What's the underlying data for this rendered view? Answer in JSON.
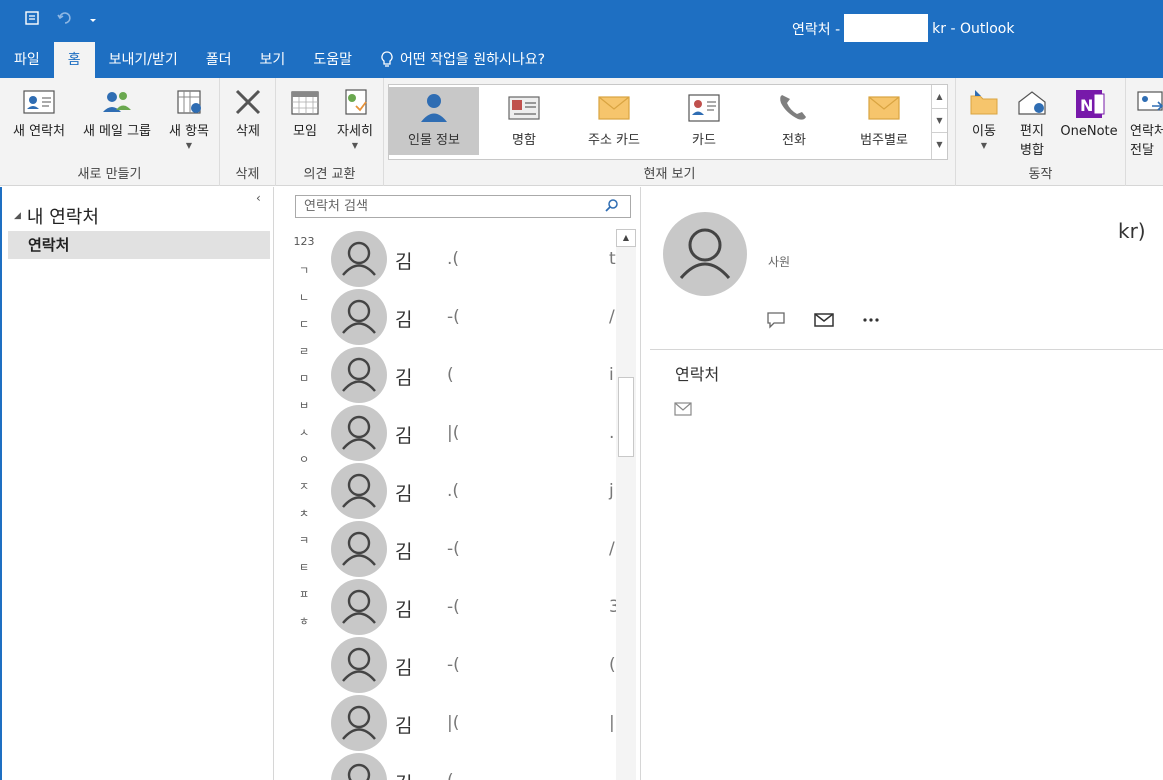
{
  "titlebar": {
    "title_prefix": "연락처 -",
    "title_suffix": "kr  -  Outlook"
  },
  "tabs": [
    {
      "label": "파일"
    },
    {
      "label": "홈"
    },
    {
      "label": "보내기/받기"
    },
    {
      "label": "폴더"
    },
    {
      "label": "보기"
    },
    {
      "label": "도움말"
    },
    {
      "label": "어떤 작업을 원하시나요?"
    }
  ],
  "ribbon": {
    "new_contact": "새 연락처",
    "new_group": "새 메일 그룹",
    "new_items": "새 항목",
    "group_new": "새로 만들기",
    "delete": "삭제",
    "group_delete": "삭제",
    "meeting": "모임",
    "more": "자세히",
    "group_communicate": "의견 교환",
    "views": [
      {
        "label": "인물 정보"
      },
      {
        "label": "명함"
      },
      {
        "label": "주소 카드"
      },
      {
        "label": "카드"
      },
      {
        "label": "전화"
      },
      {
        "label": "범주별로"
      }
    ],
    "group_current_view": "현재 보기",
    "move": "이동",
    "merge_1": "편지",
    "merge_2": "병합",
    "onenote": "OneNote",
    "forward_1": "연락처",
    "forward_2": "전달",
    "group_actions": "동작"
  },
  "nav": {
    "folder": "내 연락처",
    "item": "연락처"
  },
  "list": {
    "search_placeholder": "연락처 검색",
    "alpha": [
      "123",
      "ㄱ",
      "ㄴ",
      "ㄷ",
      "ㄹ",
      "ㅁ",
      "ㅂ",
      "ㅅ",
      "ㅇ",
      "ㅈ",
      "ㅊ",
      "ㅋ",
      "ㅌ",
      "ㅍ",
      "ㅎ"
    ],
    "contacts": [
      {
        "name": "김",
        "frag": ".(",
        "frag2": "t"
      },
      {
        "name": "김",
        "frag": "-(",
        "frag2": "/"
      },
      {
        "name": "김",
        "frag": "(",
        "frag2": "i"
      },
      {
        "name": "김",
        "frag": "|(",
        "frag2": "."
      },
      {
        "name": "김",
        "frag": ".(",
        "frag2": "j"
      },
      {
        "name": "김",
        "frag": "-(",
        "frag2": "/"
      },
      {
        "name": "김",
        "frag": "-(",
        "frag2": "3"
      },
      {
        "name": "김",
        "frag": "-(",
        "frag2": "("
      },
      {
        "name": "김",
        "frag": "|(",
        "frag2": "|"
      },
      {
        "name": "김",
        "frag": "(",
        "frag2": "."
      }
    ]
  },
  "reading": {
    "kr": "kr)",
    "role": "사원",
    "section": "연락처"
  }
}
